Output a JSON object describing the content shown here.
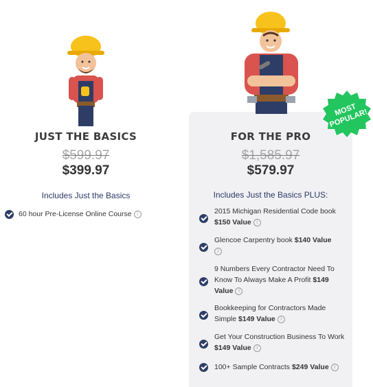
{
  "basics": {
    "title": "JUST THE BASICS",
    "old_price": "$599.97",
    "price": "$399.97",
    "includes": "Includes Just the Basics",
    "features": [
      {
        "text": "60 hour Pre-License Online Course",
        "value": ""
      }
    ]
  },
  "pro": {
    "badge_line1": "MOST",
    "badge_line2": "POPULAR!",
    "title": "FOR THE PRO",
    "old_price": "$1,585.97",
    "price": "$579.97",
    "includes": "Includes Just the Basics PLUS:",
    "features": [
      {
        "text": "2015 Michigan Residential Code book",
        "value": "$150 Value"
      },
      {
        "text": "Glencoe Carpentry book",
        "value": "$140 Value"
      },
      {
        "text": "9 Numbers Every Contractor Need To Know To Always Make A Profit",
        "value": "$149 Value"
      },
      {
        "text": "Bookkeeping for Contractors Made Simple",
        "value": "$149 Value"
      },
      {
        "text": "Get Your Construction Business To Work",
        "value": "$149 Value"
      },
      {
        "text": "100+ Sample Contracts",
        "value": "$249 Value"
      }
    ]
  },
  "info_glyph": "i",
  "colors": {
    "navy": "#2d3d66",
    "badge": "#22c55e",
    "helmet": "#f7c21b",
    "shirt": "#d9534f"
  },
  "icons": {
    "check": "check-circle-icon",
    "info": "info-icon"
  }
}
